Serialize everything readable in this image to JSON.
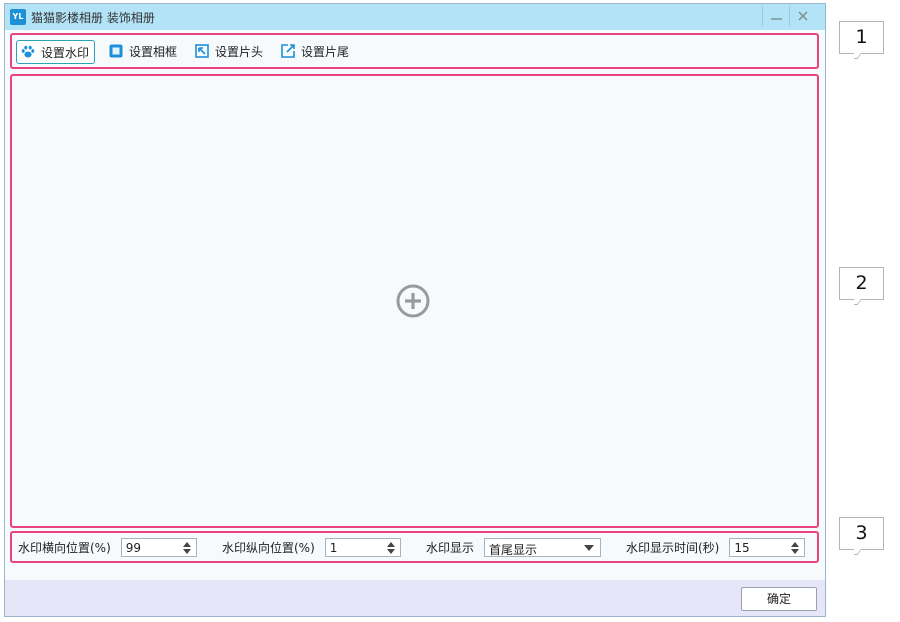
{
  "window": {
    "title": "猫猫影楼相册 装饰相册"
  },
  "toolbar": {
    "items": [
      {
        "label": "设置水印",
        "icon": "paw-icon",
        "active": true
      },
      {
        "label": "设置相框",
        "icon": "frame-icon",
        "active": false
      },
      {
        "label": "设置片头",
        "icon": "intro-icon",
        "active": false
      },
      {
        "label": "设置片尾",
        "icon": "outro-icon",
        "active": false
      }
    ]
  },
  "canvas": {
    "icon": "add-circle-icon"
  },
  "params": {
    "h_pos_label": "水印横向位置(%)",
    "h_pos_value": "99",
    "v_pos_label": "水印纵向位置(%)",
    "v_pos_value": "1",
    "display_label": "水印显示",
    "display_value": "首尾显示",
    "duration_label": "水印显示时间(秒)",
    "duration_value": "15"
  },
  "footer": {
    "ok_label": "确定"
  },
  "callouts": [
    "1",
    "2",
    "3"
  ],
  "colors": {
    "titlebar": "#b3e3f6",
    "highlight": "#e8437e",
    "accent": "#1e90d8"
  }
}
